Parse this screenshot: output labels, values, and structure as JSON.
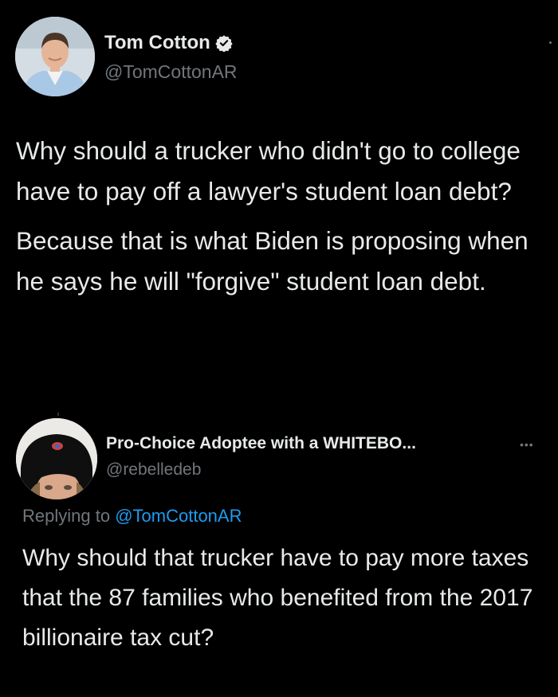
{
  "main_tweet": {
    "display_name": "Tom Cotton",
    "handle": "@TomCottonAR",
    "verified": true,
    "paragraphs": [
      "Why should a trucker who didn't go to college have to pay off a lawyer's student loan debt?",
      "Because that is what Biden is proposing when he says he will \"forgive\" student loan debt."
    ]
  },
  "reply": {
    "display_name": "Pro-Choice Adoptee with a WHITEBO...",
    "handle": "@rebelledeb",
    "more_icon": "•••",
    "replying_prefix": "Replying to",
    "replying_to": "@TomCottonAR",
    "text": "Why should that trucker have to pay more taxes that the 87 families who benefited from the 2017 billionaire tax cut?"
  },
  "colors": {
    "background": "#000000",
    "text_primary": "#e7e9ea",
    "text_secondary": "#71767b",
    "link": "#1d9bf0"
  },
  "icons": {
    "verified": "verified-badge-icon",
    "more": "more-options-icon"
  }
}
